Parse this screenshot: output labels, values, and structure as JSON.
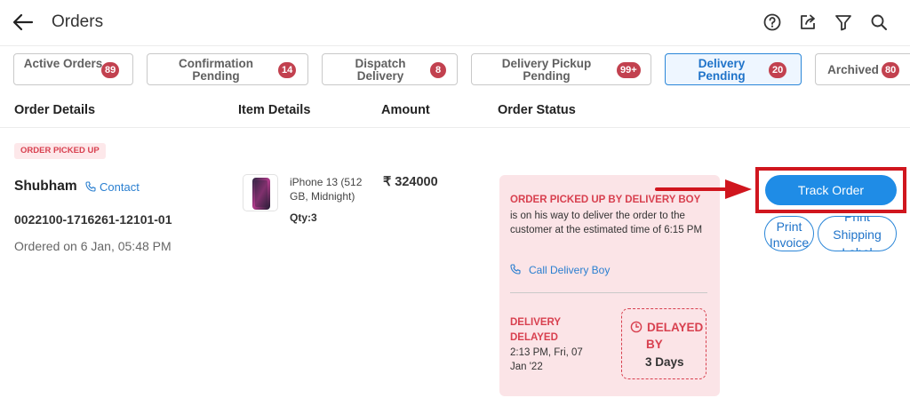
{
  "header": {
    "title": "Orders",
    "icons": [
      "back-arrow-icon",
      "help-icon",
      "share-icon",
      "filter-icon",
      "search-icon"
    ]
  },
  "tabs": [
    {
      "label": "Active Orders",
      "count": "89",
      "active": false
    },
    {
      "label": "Confirmation Pending",
      "count": "14",
      "active": false
    },
    {
      "label": "Dispatch Delivery",
      "count": "8",
      "active": false
    },
    {
      "label": "Delivery Pickup Pending",
      "count": "99+",
      "active": false
    },
    {
      "label": "Delivery Pending",
      "count": "20",
      "active": true
    },
    {
      "label": "Archived",
      "count": "80",
      "active": false
    }
  ],
  "columns": [
    "Order Details",
    "Item Details",
    "Amount",
    "Order Status"
  ],
  "order": {
    "status_pill": "ORDER PICKED UP",
    "customer": "Shubham",
    "contact_label": "Contact",
    "order_id": "0022100-1716261-12101-01",
    "ordered_on": "Ordered on 6 Jan, 05:48 PM",
    "item": {
      "name": "iPhone 13 (512 GB, Midnight)",
      "qty": "Qty:3"
    },
    "amount": "₹ 324000",
    "status": {
      "heading": "ORDER PICKED UP BY DELIVERY BOY",
      "message": "is on his way to deliver the order to the customer at the estimated time of 6:15 PM",
      "call_label": "Call Delivery Boy",
      "delay_heading": "DELIVERY DELAYED",
      "delay_time": "2:13 PM, Fri, 07 Jan '22",
      "delayed_by_line1": "DELAYED",
      "delayed_by_line2": "BY",
      "delayed_by_value": "3 Days"
    },
    "actions": {
      "track": "Track Order",
      "print_invoice": "Print Invoice",
      "print_shipping": "Print Shipping Label"
    }
  },
  "colors": {
    "accent": "#1f8ce6",
    "badge": "#c2414f",
    "alert": "#d8404f",
    "card_bg": "#fbe4e7",
    "highlight": "#d0161e"
  }
}
